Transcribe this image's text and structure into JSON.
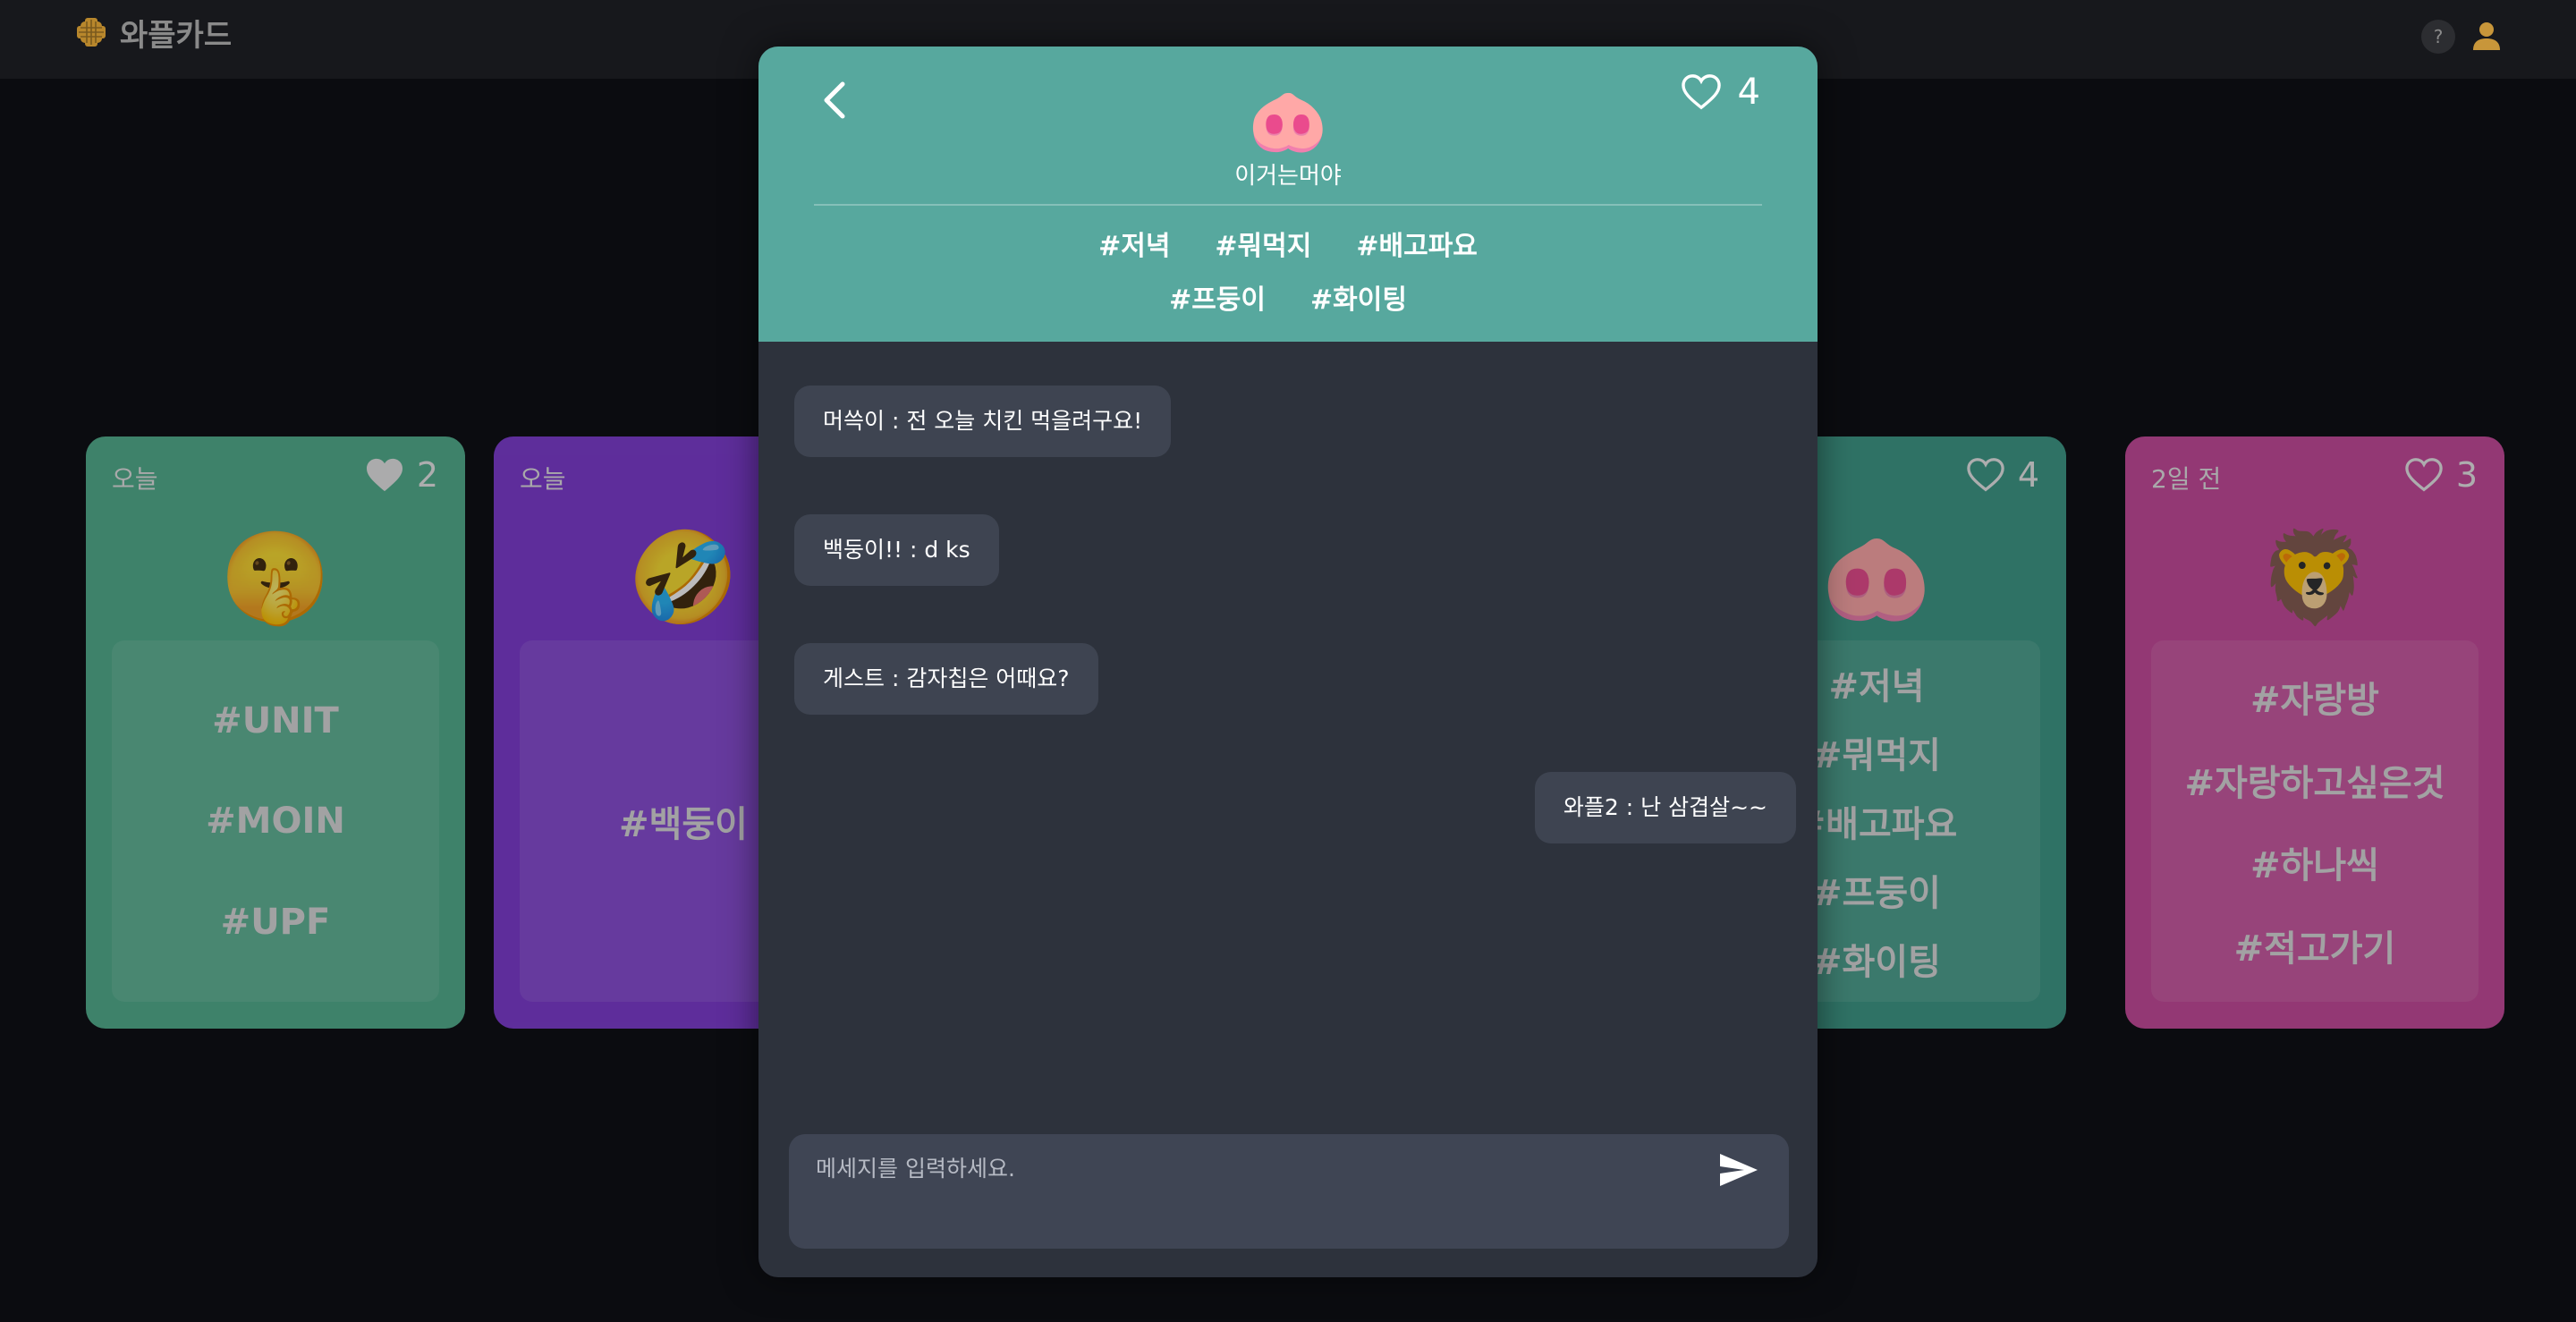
{
  "app": {
    "brand": "와플카드"
  },
  "header": {
    "help_label": "?"
  },
  "cards": [
    {
      "date": "오늘",
      "likes": "2",
      "emoji": "🤫",
      "tags": [
        "#UNIT",
        "#MOIN",
        "#UPF"
      ],
      "color": "#52b08d"
    },
    {
      "date": "오늘",
      "likes": "",
      "emoji": "🤣",
      "tags": [
        "#백둥이"
      ],
      "color": "#7e3bd1"
    },
    {
      "date": "",
      "likes": "4",
      "emoji": "🐽",
      "tags": [
        "#저녁",
        "#뭐먹지",
        "#배고파요",
        "#프둥이",
        "#화이팅"
      ],
      "color": "#3d9a86"
    },
    {
      "date": "2일 전",
      "likes": "3",
      "emoji": "🦁",
      "tags": [
        "#자랑방",
        "#자랑하고싶은것",
        "#하나씩",
        "#적고가기"
      ],
      "color": "#c84a9b"
    }
  ],
  "modal": {
    "emoji": "🐽",
    "title": "이거는머야",
    "likes": "4",
    "tags": [
      "#저녁",
      "#뭐먹지",
      "#배고파요",
      "#프둥이",
      "#화이팅"
    ],
    "header_color": "#57a89e",
    "messages": [
      {
        "text": "머쓱이 : 전 오늘 치킨 먹을려구요!",
        "side": "left"
      },
      {
        "text": "백둥이!! : d ks",
        "side": "left"
      },
      {
        "text": "게스트 : 감자칩은 어때요?",
        "side": "left"
      },
      {
        "text": "와플2 : 난 삼겹살~~",
        "side": "right"
      }
    ],
    "input": {
      "placeholder": "메세지를 입력하세요.",
      "value": ""
    },
    "icons": {
      "back": "chevron-left-icon",
      "like": "heart-outline-icon",
      "send": "send-icon"
    }
  }
}
